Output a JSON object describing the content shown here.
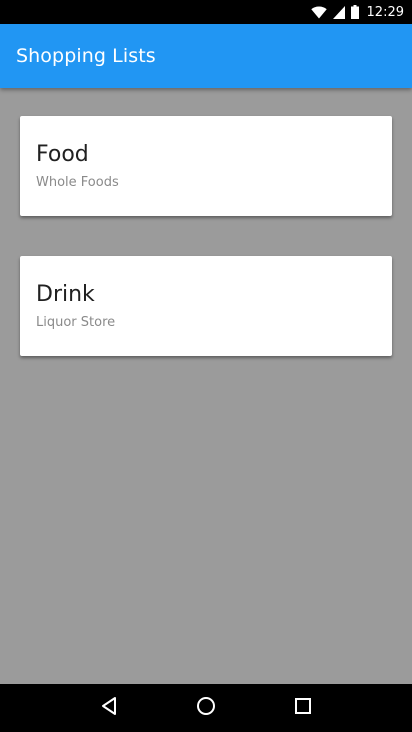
{
  "status_bar": {
    "time": "12:29",
    "icons": [
      "wifi-icon",
      "cellular-signal-icon",
      "battery-icon"
    ],
    "background": "#000000"
  },
  "app_bar": {
    "title": "Shopping Lists",
    "background": "#2196f3"
  },
  "lists": [
    {
      "name": "Food",
      "store": "Whole Foods"
    },
    {
      "name": "Drink",
      "store": "Liquor Store"
    }
  ],
  "nav_bar": {
    "buttons": [
      "back-icon",
      "home-icon",
      "recents-icon"
    ]
  },
  "colors": {
    "accent": "#2196f3",
    "content_background": "#9b9b9b",
    "card_background": "#ffffff"
  }
}
